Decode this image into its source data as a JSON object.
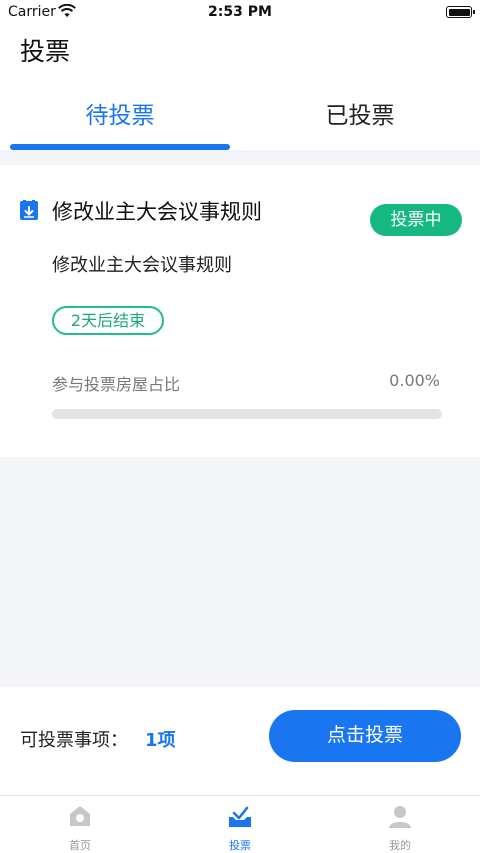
{
  "status_bar": {
    "carrier": "Carrier",
    "time": "2:53 PM"
  },
  "header": {
    "title": "投票"
  },
  "tabs": [
    {
      "label": "待投票",
      "active": true
    },
    {
      "label": "已投票",
      "active": false
    }
  ],
  "vote_item": {
    "icon": "ballot-box-icon",
    "title": "修改业主大会议事规则",
    "status": "投票中",
    "description": "修改业主大会议事规则",
    "deadline": "2天后结束",
    "ratio_label": "参与投票房屋占比",
    "ratio_value": "0.00%",
    "ratio_fraction": 0
  },
  "action_bar": {
    "votable_label": "可投票事项：",
    "votable_count": "1项",
    "vote_button": "点击投票"
  },
  "tabbar": [
    {
      "label": "首页",
      "icon": "home-icon",
      "active": false
    },
    {
      "label": "投票",
      "icon": "vote-icon",
      "active": true
    },
    {
      "label": "我的",
      "icon": "profile-icon",
      "active": false
    }
  ],
  "colors": {
    "accent": "#1976f0",
    "success": "#15b883"
  }
}
